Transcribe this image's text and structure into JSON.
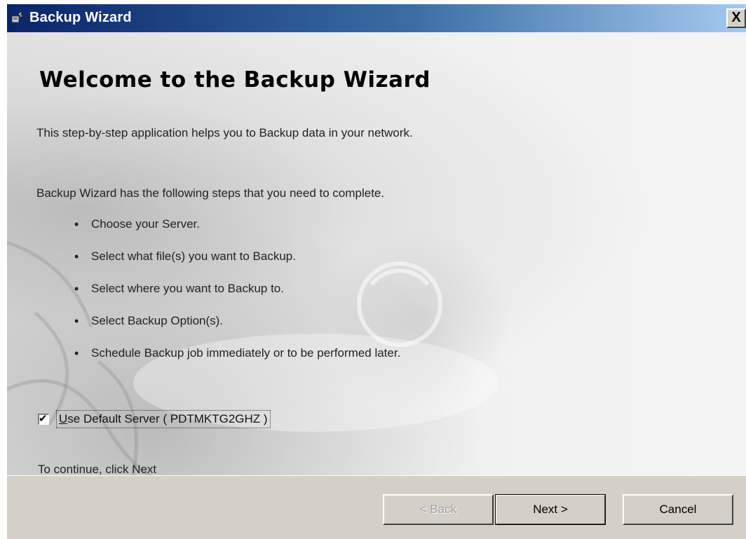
{
  "window": {
    "title": "Backup Wizard",
    "close_label": "X",
    "title_gradient": [
      "#0a246a",
      "#a6caf0"
    ]
  },
  "welcome": {
    "heading": "Welcome to the Backup Wizard",
    "intro": "This step-by-step application helps you to Backup data in your network.",
    "steps_intro": "Backup Wizard has the following steps that you need to complete.",
    "steps": [
      "Choose your Server.",
      "Select what file(s) you want to Backup.",
      "Select where you want to Backup to.",
      "Select Backup Option(s).",
      "Schedule Backup job immediately or to be performed later."
    ],
    "bullet": "•",
    "default_server": {
      "checked": true,
      "label_underlined": "U",
      "label_rest": "se Default Server ( PDTMKTG2GHZ )"
    },
    "continue_text": "To continue, click Next"
  },
  "buttons": {
    "back": "< Back",
    "next": "Next >",
    "cancel": "Cancel"
  },
  "icons": {
    "app": "wizard-app-icon",
    "close": "close-icon",
    "checkmark": "checkmark-icon",
    "watermark": "globe-watermark"
  }
}
